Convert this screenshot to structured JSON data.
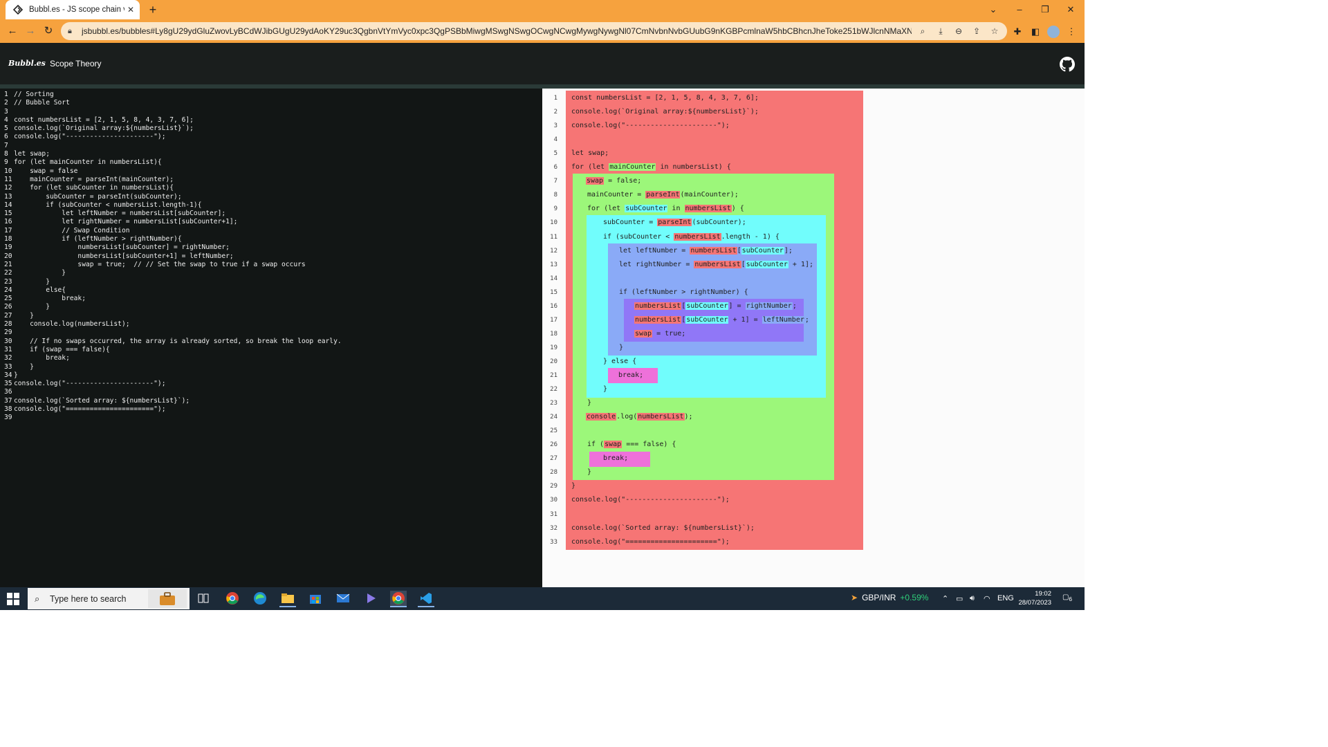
{
  "browser": {
    "tab_title": "Bubbl.es - JS scope chain visualiz",
    "url": "jsbubbl.es/bubbles#Ly8gU29ydGluZwovLyBCdWJibGUgU29ydAoKY29uc3QgbnVtYmVyc0xpc3QgPSBbMiwgMSwgNSwgOCwgNCwgMywgNywgNl07CmNvbnNvbGUubG9nKGBPcmlnaW5hbCBhcnJheToke251bWJlcnNMaXN0fWApOwpjb25...",
    "accent_color": "#f6a23e"
  },
  "app": {
    "logo": "Bubbl.es",
    "nav_link": "Scope Theory"
  },
  "editor": {
    "lines": [
      "// Sorting",
      "// Bubble Sort",
      "",
      "const numbersList = [2, 1, 5, 8, 4, 3, 7, 6];",
      "console.log(`Original array:${numbersList}`);",
      "console.log(\"----------------------\");",
      "",
      "let swap;",
      "for (let mainCounter in numbersList){",
      "    swap = false",
      "    mainCounter = parseInt(mainCounter);",
      "    for (let subCounter in numbersList){",
      "        subCounter = parseInt(subCounter);",
      "        if (subCounter < numbersList.length-1){",
      "            let leftNumber = numbersList[subCounter];",
      "            let rightNumber = numbersList[subCounter+1];",
      "            // Swap Condition",
      "            if (leftNumber > rightNumber){",
      "                numbersList[subCounter] = rightNumber;",
      "                numbersList[subCounter+1] = leftNumber;",
      "                swap = true;  // // Set the swap to true if a swap occurs",
      "            }",
      "        }",
      "        else{",
      "            break;",
      "        }",
      "    }",
      "    console.log(numbersList);",
      "",
      "    // If no swaps occurred, the array is already sorted, so break the loop early.",
      "    if (swap === false){",
      "        break;",
      "    }",
      "}",
      "console.log(\"----------------------\");",
      "",
      "console.log(`Sorted array: ${numbersList}`);",
      "console.log(\"======================\");",
      ""
    ]
  },
  "viz": {
    "line_numbers": [
      "1",
      "2",
      "3",
      "4",
      "5",
      "6",
      "7",
      "8",
      "9",
      "10",
      "11",
      "12",
      "13",
      "14",
      "15",
      "16",
      "17",
      "18",
      "19",
      "20",
      "21",
      "22",
      "23",
      "24",
      "25",
      "26",
      "27",
      "28",
      "29",
      "30",
      "31",
      "32",
      "33"
    ],
    "lines": [
      [
        {
          "t": "const numbersList = [2, 1, 5, 8, 4, 3, 7, 6];"
        }
      ],
      [
        {
          "t": "console.log(`Original array:${numbersList}`);"
        }
      ],
      [
        {
          "t": "console.log(\"----------------------\");"
        }
      ],
      [],
      [
        {
          "t": "let swap;"
        }
      ],
      [
        {
          "t": "for (let "
        },
        {
          "t": "mainCounter",
          "h": "g"
        },
        {
          "t": " in numbersList) {"
        }
      ],
      [
        {
          "t": "swap",
          "h": "r"
        },
        {
          "t": " = false;"
        }
      ],
      [
        {
          "t": "mainCounter = "
        },
        {
          "t": "parseInt",
          "h": "r"
        },
        {
          "t": "(mainCounter);"
        }
      ],
      [
        {
          "t": "for (let "
        },
        {
          "t": "subCounter",
          "h": "c"
        },
        {
          "t": " in "
        },
        {
          "t": "numbersList",
          "h": "r"
        },
        {
          "t": ") {"
        }
      ],
      [
        {
          "t": "subCounter = "
        },
        {
          "t": "parseInt",
          "h": "r"
        },
        {
          "t": "(subCounter);"
        }
      ],
      [
        {
          "t": "if (subCounter < "
        },
        {
          "t": "numbersList",
          "h": "r"
        },
        {
          "t": ".length - 1) {"
        }
      ],
      [
        {
          "t": "let leftNumber = "
        },
        {
          "t": "numbersList",
          "h": "r"
        },
        {
          "t": "["
        },
        {
          "t": "subCounter",
          "h": "c"
        },
        {
          "t": "];"
        }
      ],
      [
        {
          "t": "let rightNumber = "
        },
        {
          "t": "numbersList",
          "h": "r"
        },
        {
          "t": "["
        },
        {
          "t": "subCounter",
          "h": "c"
        },
        {
          "t": " + 1];"
        }
      ],
      [],
      [
        {
          "t": "if (leftNumber > rightNumber) {"
        }
      ],
      [
        {
          "t": "numbersList",
          "h": "r"
        },
        {
          "t": "["
        },
        {
          "t": "subCounter",
          "h": "c"
        },
        {
          "t": "] = "
        },
        {
          "t": "rightNumber",
          "h": "b"
        },
        {
          "t": ";"
        }
      ],
      [
        {
          "t": "numbersList",
          "h": "r"
        },
        {
          "t": "["
        },
        {
          "t": "subCounter",
          "h": "c"
        },
        {
          "t": " + 1] = "
        },
        {
          "t": "leftNumber",
          "h": "b"
        },
        {
          "t": ";"
        }
      ],
      [
        {
          "t": "swap",
          "h": "r"
        },
        {
          "t": " = true;"
        }
      ],
      [
        {
          "t": "}"
        }
      ],
      [
        {
          "t": "} else {"
        }
      ],
      [
        {
          "t": "break;"
        }
      ],
      [
        {
          "t": "}"
        }
      ],
      [
        {
          "t": "}"
        }
      ],
      [
        {
          "t": "console",
          "h": "r"
        },
        {
          "t": ".log("
        },
        {
          "t": "numbersList",
          "h": "r"
        },
        {
          "t": ");"
        }
      ],
      [],
      [
        {
          "t": "if ("
        },
        {
          "t": "swap",
          "h": "r"
        },
        {
          "t": " === false) {"
        }
      ],
      [
        {
          "t": "break;"
        }
      ],
      [
        {
          "t": "}"
        }
      ],
      [
        {
          "t": "}"
        }
      ],
      [
        {
          "t": "console.log(\"----------------------\");"
        }
      ],
      [],
      [
        {
          "t": "console.log(`Sorted array: ${numbersList}`);"
        }
      ],
      [
        {
          "t": "console.log(\"======================\");"
        }
      ]
    ],
    "scope_colors": {
      "global": "#f67575",
      "for_main": "#9cf77a",
      "for_sub": "#71fdfc",
      "if_block": "#8aaaf7",
      "if_swap": "#9077f7",
      "break_block": "#ee71da"
    }
  },
  "taskbar": {
    "search_placeholder": "Type here to search",
    "fx_pair": "GBP/INR",
    "fx_change": "+0.59%",
    "lang": "ENG",
    "time": "19:02",
    "date": "28/07/2023",
    "notif_count": "6"
  }
}
